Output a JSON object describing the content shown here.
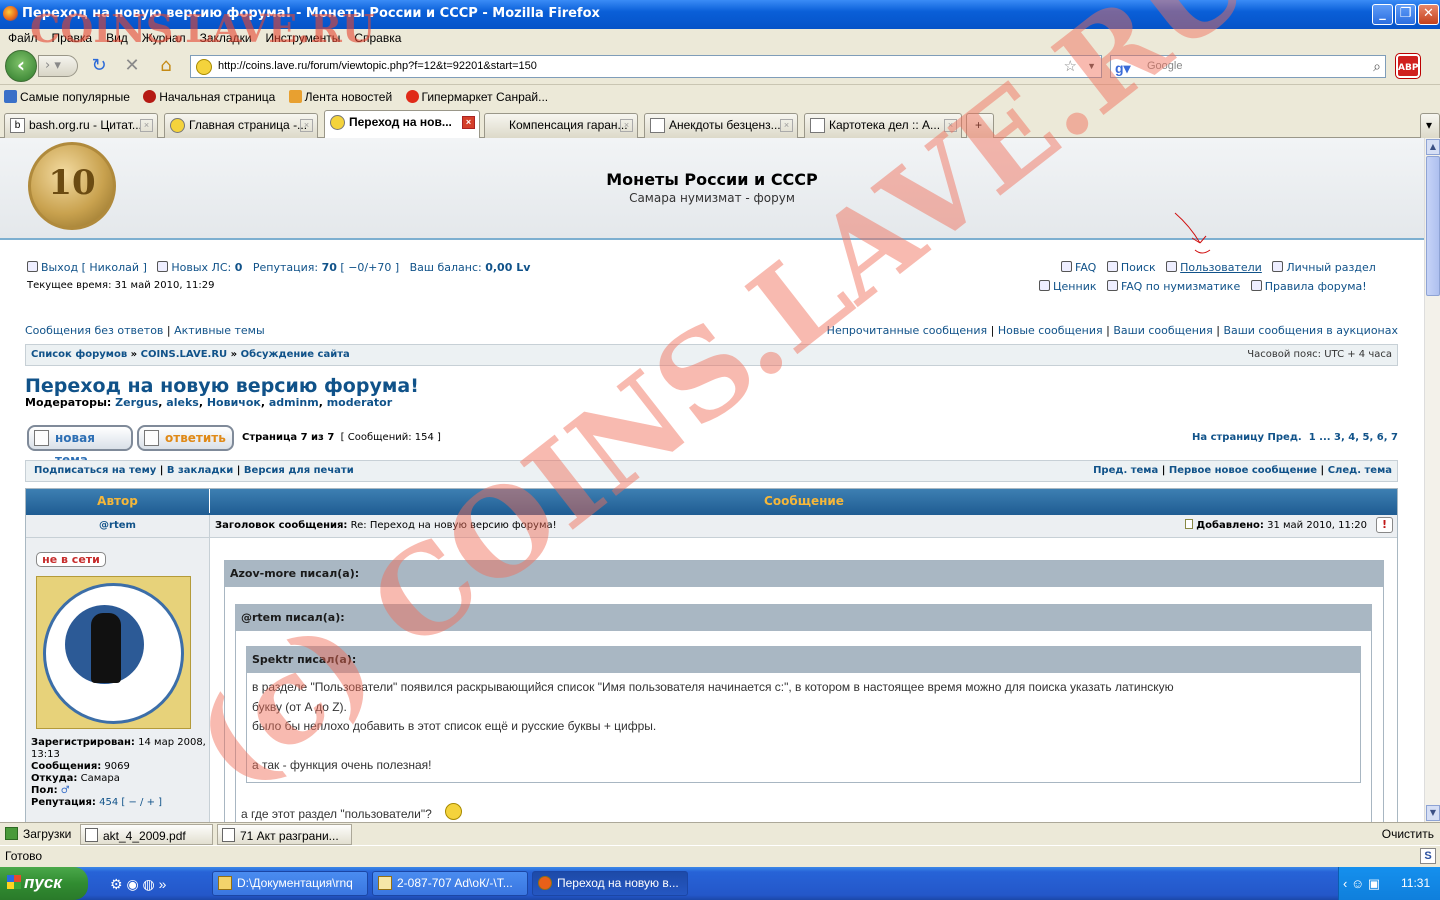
{
  "window": {
    "title": "Переход на новую версию форума! - Монеты России и СССР - Mozilla Firefox"
  },
  "menu": [
    "Файл",
    "Правка",
    "Вид",
    "Журнал",
    "Закладки",
    "Инструменты",
    "Справка"
  ],
  "nav": {
    "url": "http://coins.lave.ru/forum/viewtopic.php?f=12&t=92201&start=150",
    "search_placeholder": "Google",
    "abp": "ABP"
  },
  "bookmarks": [
    "Самые популярные",
    "Начальная страница",
    "Лента новостей",
    "Гипермаркет Санрай..."
  ],
  "tabs": [
    {
      "label": "bash.org.ru - Цитат...",
      "icon": "b"
    },
    {
      "label": "Главная страница -...",
      "icon": "smile"
    },
    {
      "label": "Переход на нов...",
      "icon": "smile",
      "active": true
    },
    {
      "label": "Компенсация гаран...",
      "icon": ""
    },
    {
      "label": "Анекдоты безценз...",
      "icon": "page"
    },
    {
      "label": "Картотека дел :: А...",
      "icon": "page"
    }
  ],
  "site": {
    "title": "Монеты России и СССР",
    "subtitle": "Самара нумизмат - форум",
    "coin_value": "10"
  },
  "userbar": {
    "logout": "Выход [ Николай ]",
    "new_pm_label": "Новых ЛС:",
    "new_pm_value": "0",
    "rep_label": "Репутация:",
    "rep_value": "70",
    "rep_detail": "[ −0/+70 ]",
    "balance_label": "Ваш баланс:",
    "balance_value": "0,00 Lv",
    "time": "Текущее время: 31 май 2010, 11:29",
    "faq": "FAQ",
    "search": "Поиск",
    "users": "Пользователи",
    "ucp": "Личный раздел",
    "prices": "Ценник",
    "faq_num": "FAQ по нумизматике",
    "rules": "Правила форума!"
  },
  "quicklinks": {
    "left": [
      "Сообщения без ответов",
      "Активные темы"
    ],
    "right": [
      "Непрочитанные сообщения",
      "Новые сообщения",
      "Ваши сообщения",
      "Ваши сообщения в аукционах"
    ]
  },
  "breadcrumb": {
    "items": [
      "Список форумов",
      "COINS.LAVE.RU",
      "Обсуждение сайта"
    ],
    "timezone": "Часовой пояс: UTC + 4 часа"
  },
  "topic": {
    "title": "Переход на новую версию форума!",
    "moderators_label": "Модераторы:",
    "moderators": [
      "Zergus",
      "aleks",
      "Новичок",
      "adminm",
      "moderator"
    ],
    "new_topic": "новая тема",
    "reply": "ответить",
    "page_info": "Страница 7 из 7",
    "post_count": "[ Сообщений: 154 ]",
    "pagination_label": "На страницу",
    "prev": "Пред.",
    "pages": [
      "1",
      "...",
      "3",
      "4",
      "5",
      "6",
      "7"
    ]
  },
  "topicbar": {
    "left": [
      "Подписаться на тему",
      "В закладки",
      "Версия для печати"
    ],
    "right": [
      "Пред. тема",
      "Первое новое сообщение",
      "След. тема"
    ]
  },
  "table": {
    "author_header": "Автор",
    "message_header": "Сообщение"
  },
  "post": {
    "author": "@rtem",
    "subject_label": "Заголовок сообщения:",
    "subject": "Re: Переход на новую версию форума!",
    "added_label": "Добавлено:",
    "added": "31 май 2010, 11:20",
    "status": "не в сети",
    "registered_label": "Зарегистрирован:",
    "registered": "14 мар 2008, 13:13",
    "posts_label": "Сообщения:",
    "posts": "9069",
    "from_label": "Откуда:",
    "from": "Самара",
    "sex_label": "Пол:",
    "rep_label": "Репутация:",
    "rep": "454",
    "rep_ctrl": "[ − / + ]",
    "quote1_header": "Azov-more писал(а):",
    "quote2_header": "@rtem писал(а):",
    "quote3_header": "Spektr писал(а):",
    "quote3_lines": [
      "в разделе \"Пользователи\" появился раскрывающийся список \"Имя пользователя начинается с:\", в котором в настоящее время можно для поиска указать латинскую",
      "букву (от A до Z).",
      "было бы неплохо добавить в этот список ещё и русские буквы + цифры.",
      "",
      "а так - функция очень полезная!"
    ],
    "quote2_tail": "а где этот раздел \"пользователи\"?"
  },
  "watermark": {
    "top": "COINS.LAVE.RU",
    "main": "(c) COINS.LAVE.RU"
  },
  "downloads": {
    "label": "Загрузки",
    "items": [
      "akt_4_2009.pdf",
      "71 Акт разграни..."
    ],
    "clear": "Очистить"
  },
  "status": "Готово",
  "taskbar": {
    "start": "пуск",
    "items": [
      "D:\\Документация\\rnq",
      "2-087-707 Ad\\оК/-\\Т...",
      "Переход на новую в..."
    ],
    "clock": "11:31"
  },
  "colors": {
    "link": "#105289",
    "header_blue": "#1f5c92",
    "header_orange": "#f5b73a",
    "watermark": "#f06e5a"
  }
}
